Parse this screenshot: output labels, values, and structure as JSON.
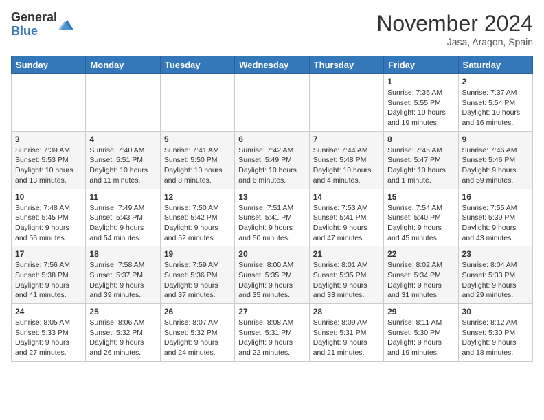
{
  "header": {
    "logo_general": "General",
    "logo_blue": "Blue",
    "month_title": "November 2024",
    "location": "Jasa, Aragon, Spain"
  },
  "weekdays": [
    "Sunday",
    "Monday",
    "Tuesday",
    "Wednesday",
    "Thursday",
    "Friday",
    "Saturday"
  ],
  "weeks": [
    [
      {
        "day": "",
        "info": ""
      },
      {
        "day": "",
        "info": ""
      },
      {
        "day": "",
        "info": ""
      },
      {
        "day": "",
        "info": ""
      },
      {
        "day": "",
        "info": ""
      },
      {
        "day": "1",
        "info": "Sunrise: 7:36 AM\nSunset: 5:55 PM\nDaylight: 10 hours and 19 minutes."
      },
      {
        "day": "2",
        "info": "Sunrise: 7:37 AM\nSunset: 5:54 PM\nDaylight: 10 hours and 16 minutes."
      }
    ],
    [
      {
        "day": "3",
        "info": "Sunrise: 7:39 AM\nSunset: 5:53 PM\nDaylight: 10 hours and 13 minutes."
      },
      {
        "day": "4",
        "info": "Sunrise: 7:40 AM\nSunset: 5:51 PM\nDaylight: 10 hours and 11 minutes."
      },
      {
        "day": "5",
        "info": "Sunrise: 7:41 AM\nSunset: 5:50 PM\nDaylight: 10 hours and 8 minutes."
      },
      {
        "day": "6",
        "info": "Sunrise: 7:42 AM\nSunset: 5:49 PM\nDaylight: 10 hours and 6 minutes."
      },
      {
        "day": "7",
        "info": "Sunrise: 7:44 AM\nSunset: 5:48 PM\nDaylight: 10 hours and 4 minutes."
      },
      {
        "day": "8",
        "info": "Sunrise: 7:45 AM\nSunset: 5:47 PM\nDaylight: 10 hours and 1 minute."
      },
      {
        "day": "9",
        "info": "Sunrise: 7:46 AM\nSunset: 5:46 PM\nDaylight: 9 hours and 59 minutes."
      }
    ],
    [
      {
        "day": "10",
        "info": "Sunrise: 7:48 AM\nSunset: 5:45 PM\nDaylight: 9 hours and 56 minutes."
      },
      {
        "day": "11",
        "info": "Sunrise: 7:49 AM\nSunset: 5:43 PM\nDaylight: 9 hours and 54 minutes."
      },
      {
        "day": "12",
        "info": "Sunrise: 7:50 AM\nSunset: 5:42 PM\nDaylight: 9 hours and 52 minutes."
      },
      {
        "day": "13",
        "info": "Sunrise: 7:51 AM\nSunset: 5:41 PM\nDaylight: 9 hours and 50 minutes."
      },
      {
        "day": "14",
        "info": "Sunrise: 7:53 AM\nSunset: 5:41 PM\nDaylight: 9 hours and 47 minutes."
      },
      {
        "day": "15",
        "info": "Sunrise: 7:54 AM\nSunset: 5:40 PM\nDaylight: 9 hours and 45 minutes."
      },
      {
        "day": "16",
        "info": "Sunrise: 7:55 AM\nSunset: 5:39 PM\nDaylight: 9 hours and 43 minutes."
      }
    ],
    [
      {
        "day": "17",
        "info": "Sunrise: 7:56 AM\nSunset: 5:38 PM\nDaylight: 9 hours and 41 minutes."
      },
      {
        "day": "18",
        "info": "Sunrise: 7:58 AM\nSunset: 5:37 PM\nDaylight: 9 hours and 39 minutes."
      },
      {
        "day": "19",
        "info": "Sunrise: 7:59 AM\nSunset: 5:36 PM\nDaylight: 9 hours and 37 minutes."
      },
      {
        "day": "20",
        "info": "Sunrise: 8:00 AM\nSunset: 5:35 PM\nDaylight: 9 hours and 35 minutes."
      },
      {
        "day": "21",
        "info": "Sunrise: 8:01 AM\nSunset: 5:35 PM\nDaylight: 9 hours and 33 minutes."
      },
      {
        "day": "22",
        "info": "Sunrise: 8:02 AM\nSunset: 5:34 PM\nDaylight: 9 hours and 31 minutes."
      },
      {
        "day": "23",
        "info": "Sunrise: 8:04 AM\nSunset: 5:33 PM\nDaylight: 9 hours and 29 minutes."
      }
    ],
    [
      {
        "day": "24",
        "info": "Sunrise: 8:05 AM\nSunset: 5:33 PM\nDaylight: 9 hours and 27 minutes."
      },
      {
        "day": "25",
        "info": "Sunrise: 8:06 AM\nSunset: 5:32 PM\nDaylight: 9 hours and 26 minutes."
      },
      {
        "day": "26",
        "info": "Sunrise: 8:07 AM\nSunset: 5:32 PM\nDaylight: 9 hours and 24 minutes."
      },
      {
        "day": "27",
        "info": "Sunrise: 8:08 AM\nSunset: 5:31 PM\nDaylight: 9 hours and 22 minutes."
      },
      {
        "day": "28",
        "info": "Sunrise: 8:09 AM\nSunset: 5:31 PM\nDaylight: 9 hours and 21 minutes."
      },
      {
        "day": "29",
        "info": "Sunrise: 8:11 AM\nSunset: 5:30 PM\nDaylight: 9 hours and 19 minutes."
      },
      {
        "day": "30",
        "info": "Sunrise: 8:12 AM\nSunset: 5:30 PM\nDaylight: 9 hours and 18 minutes."
      }
    ]
  ]
}
